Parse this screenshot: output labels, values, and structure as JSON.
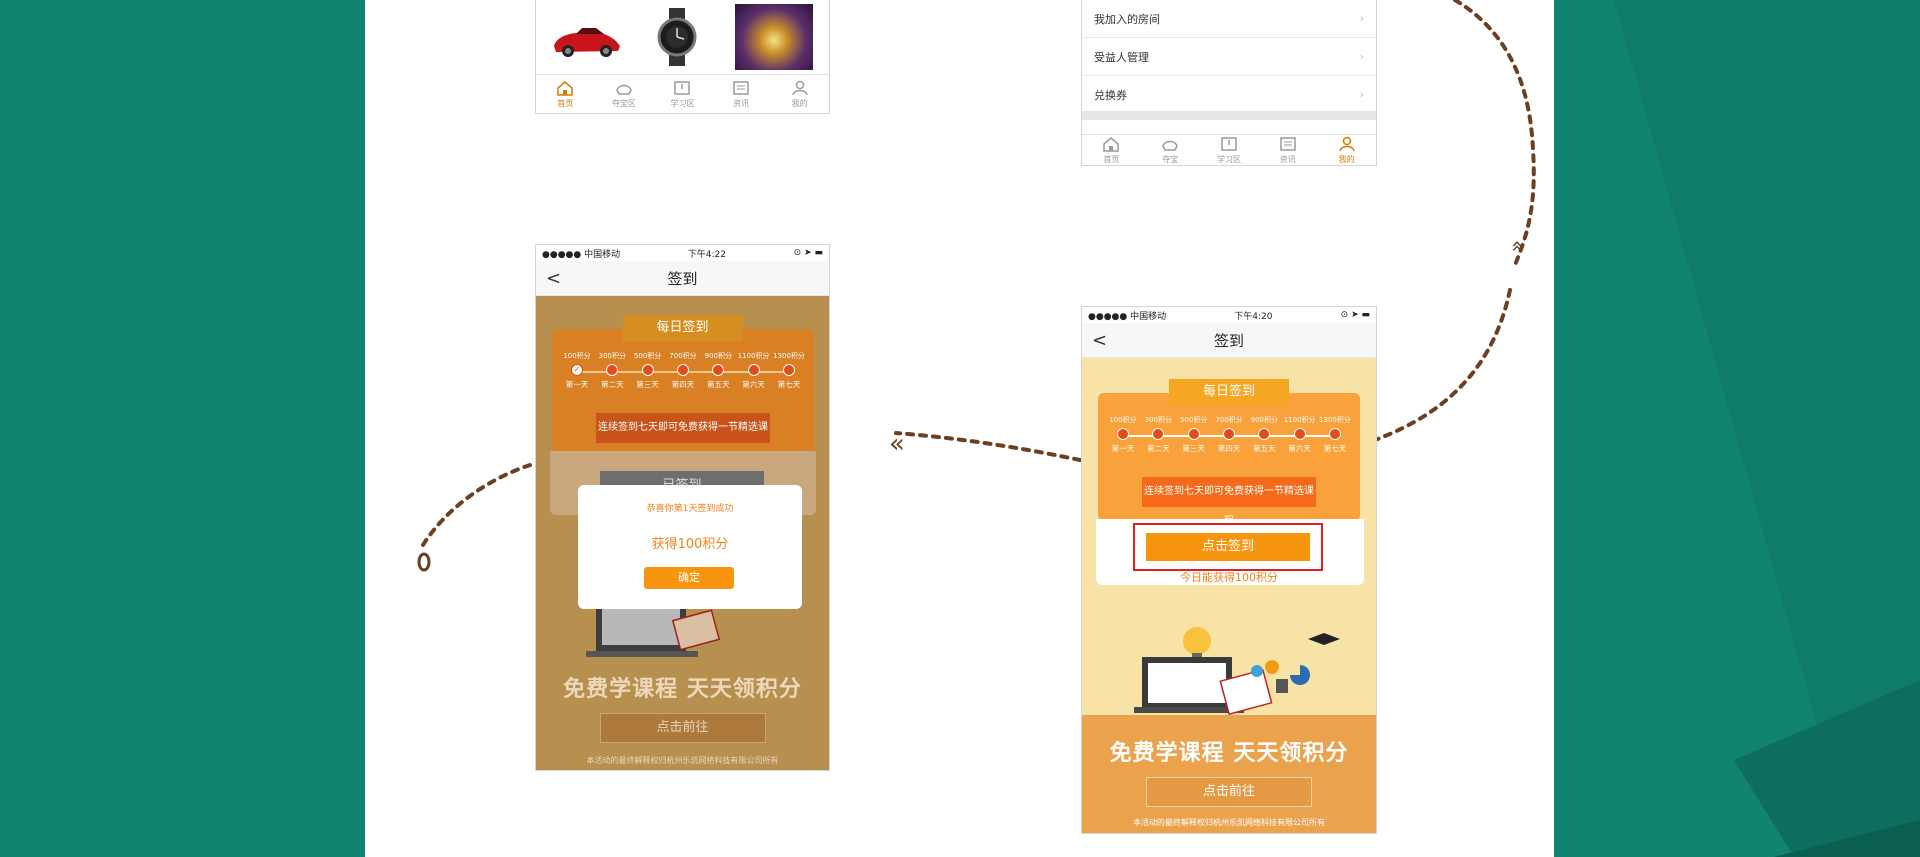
{
  "colors": {
    "teal": "#108470",
    "accent_orange": "#f0821e",
    "highlight_red": "#e02020",
    "path_brown": "#6b3f1f"
  },
  "phone_home": {
    "tabs": [
      {
        "label": "首页",
        "icon": "home-icon",
        "active": true
      },
      {
        "label": "夺宝区",
        "icon": "gold-ingot-icon",
        "active": false
      },
      {
        "label": "学习区",
        "icon": "book-icon",
        "active": false
      },
      {
        "label": "资讯",
        "icon": "news-icon",
        "active": false
      },
      {
        "label": "我的",
        "icon": "user-icon",
        "active": false
      }
    ],
    "products": [
      {
        "name": "red-sports-car",
        "icon": "car-image"
      },
      {
        "name": "black-wristwatch",
        "icon": "watch-image"
      },
      {
        "name": "game-artwork",
        "icon": "game-image"
      }
    ]
  },
  "phone_profile": {
    "menu": [
      {
        "label": "我加入的房间"
      },
      {
        "label": "受益人管理"
      },
      {
        "label": "兑换券"
      }
    ],
    "tabs": [
      {
        "label": "首页",
        "icon": "home-icon",
        "active": false
      },
      {
        "label": "夺宝",
        "icon": "gold-ingot-icon",
        "active": false
      },
      {
        "label": "学习区",
        "icon": "book-icon",
        "active": false
      },
      {
        "label": "资讯",
        "icon": "news-icon",
        "active": false
      },
      {
        "label": "我的",
        "icon": "user-icon",
        "active": true
      }
    ]
  },
  "phone_checkin_done": {
    "status": {
      "carrier": "●●●●● 中国移动",
      "time": "下午4:22"
    },
    "nav_title": "签到",
    "banner": "每日签到",
    "steps": [
      {
        "pts": "100积分",
        "day": "第一天"
      },
      {
        "pts": "300积分",
        "day": "第二天"
      },
      {
        "pts": "500积分",
        "day": "第三天"
      },
      {
        "pts": "700积分",
        "day": "第四天"
      },
      {
        "pts": "900积分",
        "day": "第五天"
      },
      {
        "pts": "1100积分",
        "day": "第六天"
      },
      {
        "pts": "1300积分",
        "day": "第七天"
      }
    ],
    "promo": "连续签到七天即可免费获得一节精选课程",
    "behind_button": "已签到",
    "dialog": {
      "line1": "恭喜你第1天签到成功",
      "line2": "获得100积分",
      "confirm": "确定"
    },
    "slogan": "免费学课程 天天领积分",
    "go_button": "点击前往",
    "copyright": "本活动的最终解释权归杭州乐凯网络科技有限公司所有"
  },
  "phone_checkin": {
    "status": {
      "carrier": "●●●●● 中国移动",
      "time": "下午4:20"
    },
    "nav_title": "签到",
    "banner": "每日签到",
    "steps": [
      {
        "pts": "100积分",
        "day": "第一天"
      },
      {
        "pts": "300积分",
        "day": "第二天"
      },
      {
        "pts": "500积分",
        "day": "第三天"
      },
      {
        "pts": "700积分",
        "day": "第四天"
      },
      {
        "pts": "900积分",
        "day": "第五天"
      },
      {
        "pts": "1100积分",
        "day": "第六天"
      },
      {
        "pts": "1300积分",
        "day": "第七天"
      }
    ],
    "promo": "连续签到七天即可免费获得一节精选课程",
    "checkin_button": "点击签到",
    "today_hint": "今日能获得100积分",
    "slogan": "免费学课程 天天领积分",
    "go_button": "点击前往",
    "copyright": "本活动的最终解释权归杭州乐凯网络科技有限公司所有"
  }
}
